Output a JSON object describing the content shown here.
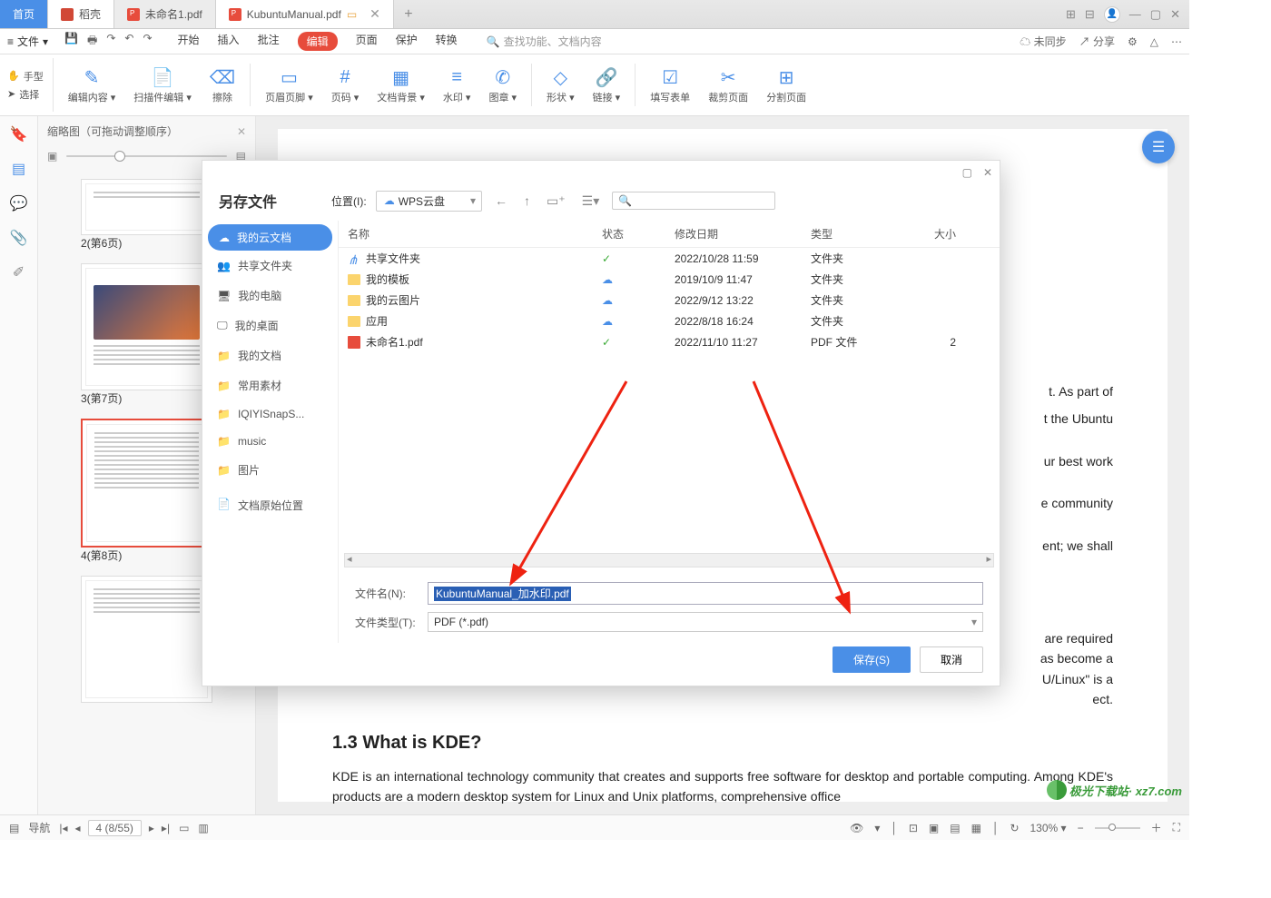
{
  "tabs": {
    "home": "首页",
    "doke": "稻壳",
    "file1": "未命名1.pdf",
    "file2": "KubuntuManual.pdf"
  },
  "win_icons": {
    "grid1": "⊞",
    "grid2": "⊟",
    "avatar": "👤",
    "min": "—",
    "max": "▢",
    "close": "✕"
  },
  "menubar": {
    "file": "文件",
    "file_caret": "▾",
    "tools": {
      "save": "💾",
      "print": "🖶",
      "sep": "↷",
      "undo": "↶",
      "redo": "↷"
    },
    "menus": {
      "start": "开始",
      "insert": "插入",
      "annotate": "批注",
      "edit": "编辑",
      "page": "页面",
      "protect": "保护",
      "convert": "转换"
    },
    "search_placeholder": "查找功能、文档内容",
    "right": {
      "unsync": "未同步",
      "share": "分享",
      "gear": "⚙",
      "tri": "△",
      "dots": "⋯"
    }
  },
  "ribbon": {
    "hand": "手型",
    "select": "选择",
    "tools": [
      {
        "ico": "✎",
        "label": "编辑内容 ▾"
      },
      {
        "ico": "📄",
        "label": "扫描件编辑 ▾"
      },
      {
        "ico": "⌫",
        "label": "擦除"
      },
      {
        "ico": "▭",
        "label": "页眉页脚 ▾"
      },
      {
        "ico": "#",
        "label": "页码 ▾"
      },
      {
        "ico": "▦",
        "label": "文档背景 ▾"
      },
      {
        "ico": "≡",
        "label": "水印 ▾"
      },
      {
        "ico": "✆",
        "label": "图章 ▾"
      },
      {
        "ico": "◇",
        "label": "形状 ▾"
      },
      {
        "ico": "🔗",
        "label": "链接 ▾"
      },
      {
        "ico": "☑",
        "label": "填写表单"
      },
      {
        "ico": "✂",
        "label": "裁剪页面"
      },
      {
        "ico": "⊞",
        "label": "分割页面"
      }
    ]
  },
  "leftbar": {
    "bookmark": "🔖",
    "thumbs": "▤",
    "comment": "💬",
    "attach": "📎",
    "sign": "✐"
  },
  "thumb_panel": {
    "title": "缩略图（可拖动调整顺序）",
    "pages": [
      {
        "label": "2(第6页)",
        "short": true
      },
      {
        "label": "3(第7页)",
        "img": true
      },
      {
        "label": "4(第8页)",
        "selected": true
      },
      {
        "label": ""
      }
    ]
  },
  "doc": {
    "para1_end": "t.  As part of",
    "para2_end": "t the Ubuntu",
    "para3_end": "ur best work",
    "para4_end": "e community",
    "para5_end": "ent; we shall",
    "para6": "are required\n as become a\nU/Linux\" is a\nect.",
    "h3": "1.3  What is KDE?",
    "para7": "KDE is an international technology community that creates and supports free software for desktop and portable computing.  Among KDE's products are a modern desktop system for Linux and Unix platforms, comprehensive office"
  },
  "dialog": {
    "title": "另存文件",
    "loc_label": "位置(I):",
    "loc_value": "WPS云盘",
    "sidebar": [
      "我的云文档",
      "共享文件夹",
      "我的电脑",
      "我的桌面",
      "我的文档",
      "常用素材",
      "IQIYISnapS...",
      "music",
      "图片"
    ],
    "origin": "文档原始位置",
    "headers": {
      "name": "名称",
      "status": "状态",
      "date": "修改日期",
      "type": "类型",
      "size": "大小"
    },
    "rows": [
      {
        "icon": "share",
        "name": "共享文件夹",
        "status": "ok",
        "date": "2022/10/28 11:59",
        "type": "文件夹",
        "size": ""
      },
      {
        "icon": "folder",
        "name": "我的模板",
        "status": "cloud",
        "date": "2019/10/9 11:47",
        "type": "文件夹",
        "size": ""
      },
      {
        "icon": "folder",
        "name": "我的云图片",
        "status": "cloud",
        "date": "2022/9/12 13:22",
        "type": "文件夹",
        "size": ""
      },
      {
        "icon": "folder",
        "name": "应用",
        "status": "cloud",
        "date": "2022/8/18 16:24",
        "type": "文件夹",
        "size": ""
      },
      {
        "icon": "pdf",
        "name": "未命名1.pdf",
        "status": "ok",
        "date": "2022/11/10 11:27",
        "type": "PDF 文件",
        "size": "2"
      }
    ],
    "filename_label": "文件名(N):",
    "filename_value": "KubuntuManual_加水印.pdf",
    "filetype_label": "文件类型(T):",
    "filetype_value": "PDF (*.pdf)",
    "save": "保存(S)",
    "cancel": "取消"
  },
  "status": {
    "nav": "导航",
    "first": "|◂",
    "prev": "◂",
    "page": "4 (8/55)",
    "next": "▸",
    "last": "▸|",
    "ic": {
      "a": "▭",
      "b": "▥",
      "eye": "👁",
      "sep": "│",
      "fit1": "⊡",
      "fit2": "▣",
      "fit3": "▤",
      "fit4": "▦",
      "rot": "↻",
      "zoom": "130% ▾",
      "minus": "−",
      "plus": "＋",
      "full": "⛶"
    }
  },
  "watermark": "极光下载站· xz7.com"
}
